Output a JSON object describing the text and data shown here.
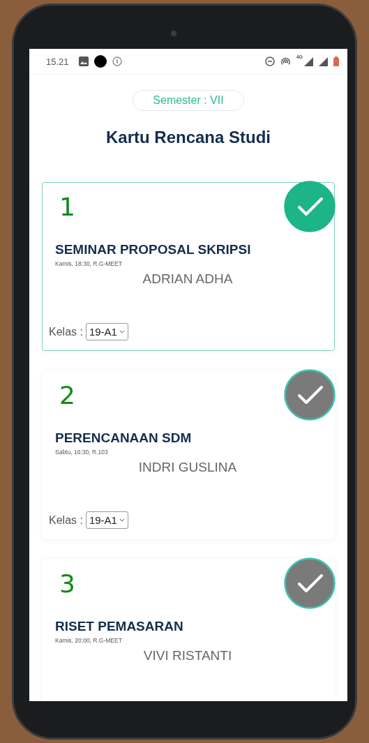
{
  "status_bar": {
    "time": "15.21",
    "network_type": "4G"
  },
  "semester": "Semester : VII",
  "title": "Kartu Rencana Studi",
  "courses": [
    {
      "number": "1",
      "name": "SEMINAR PROPOSAL SKRIPSI",
      "schedule": "Kamis, 18:30, R.G-MEET",
      "lecturer": "ADRIAN ADHA",
      "class_label": "Kelas :",
      "class_value": "19-A1",
      "selected": true
    },
    {
      "number": "2",
      "name": "PERENCANAAN SDM",
      "schedule": "Sabtu, 16:30, R.103",
      "lecturer": "INDRI GUSLINA",
      "class_label": "Kelas :",
      "class_value": "19-A1",
      "selected": false
    },
    {
      "number": "3",
      "name": "RISET PEMASARAN",
      "schedule": "Kamis, 20:00, R.G-MEET",
      "lecturer": "VIVI RISTANTI",
      "selected": false
    }
  ]
}
